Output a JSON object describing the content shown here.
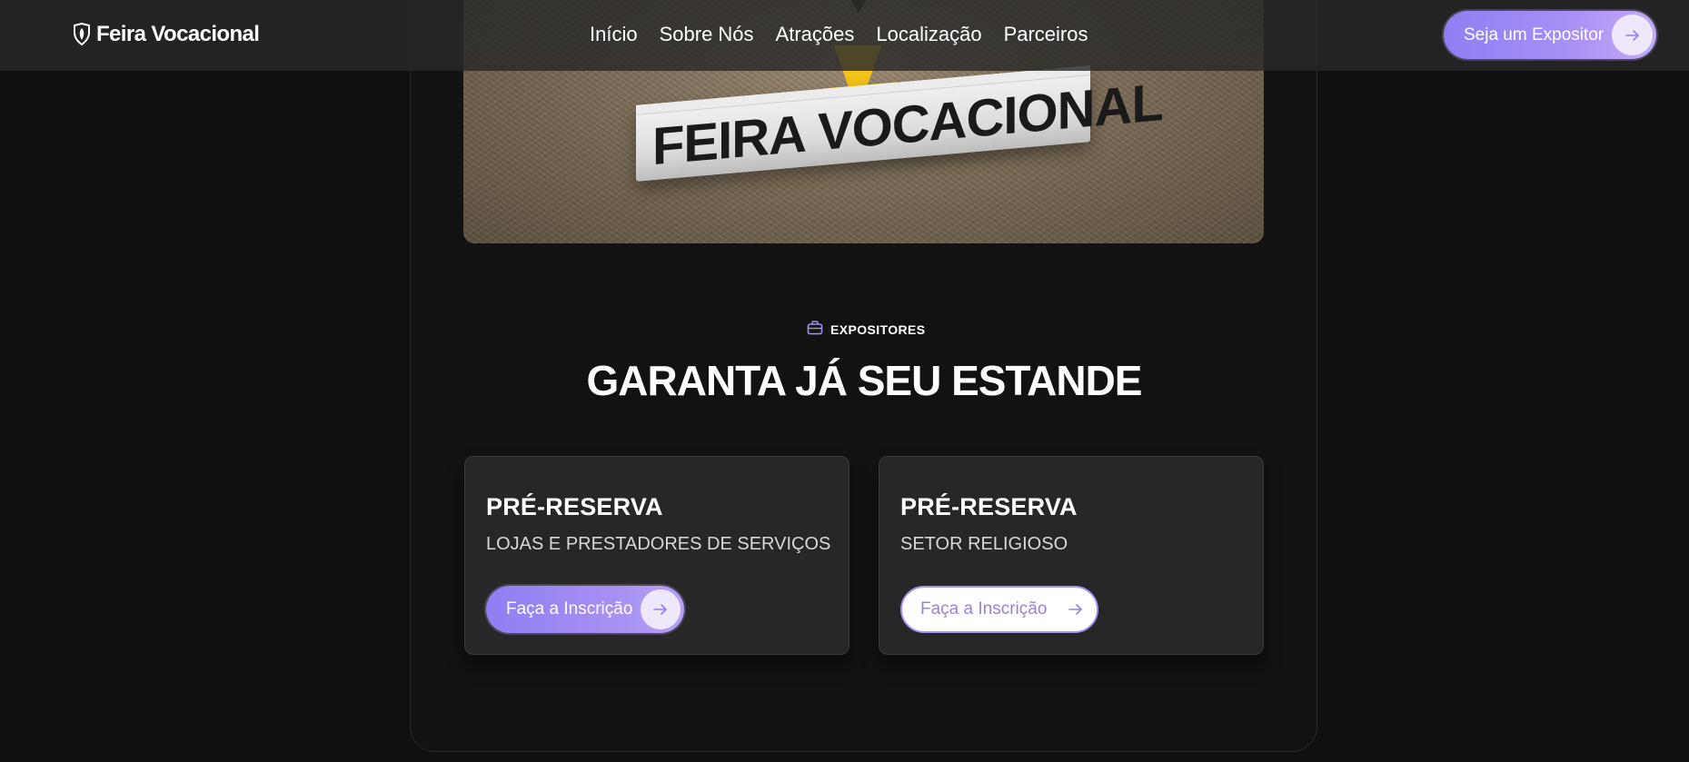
{
  "header": {
    "brand_name": "Feira Vocacional",
    "brand_icon": "shield-leaf-icon",
    "nav": [
      {
        "label": "Início"
      },
      {
        "label": "Sobre Nós"
      },
      {
        "label": "Atrações"
      },
      {
        "label": "Localização"
      },
      {
        "label": "Parceiros"
      }
    ],
    "cta_label": "Seja um Expositor",
    "cta_icon": "arrow-right-icon"
  },
  "hero": {
    "sign_text": "FEIRA VOCACIONAL"
  },
  "section": {
    "eyebrow_icon": "briefcase-icon",
    "eyebrow": "EXPOSITORES",
    "title": "GARANTA JÁ SEU ESTANDE"
  },
  "cards": [
    {
      "title": "PRÉ-RESERVA",
      "subtitle": "LOJAS E PRESTADORES DE SERVIÇOS",
      "button_label": "Faça a Inscrição",
      "button_style": "filled"
    },
    {
      "title": "PRÉ-RESERVA",
      "subtitle": "SETOR RELIGIOSO",
      "button_label": "Faça a Inscrição",
      "button_style": "outline"
    }
  ],
  "colors": {
    "accent": "#a68ef5",
    "accent_start": "#8f7ff3",
    "background": "#0f0f0f",
    "card": "#272727",
    "nav_bar": "#282828"
  }
}
